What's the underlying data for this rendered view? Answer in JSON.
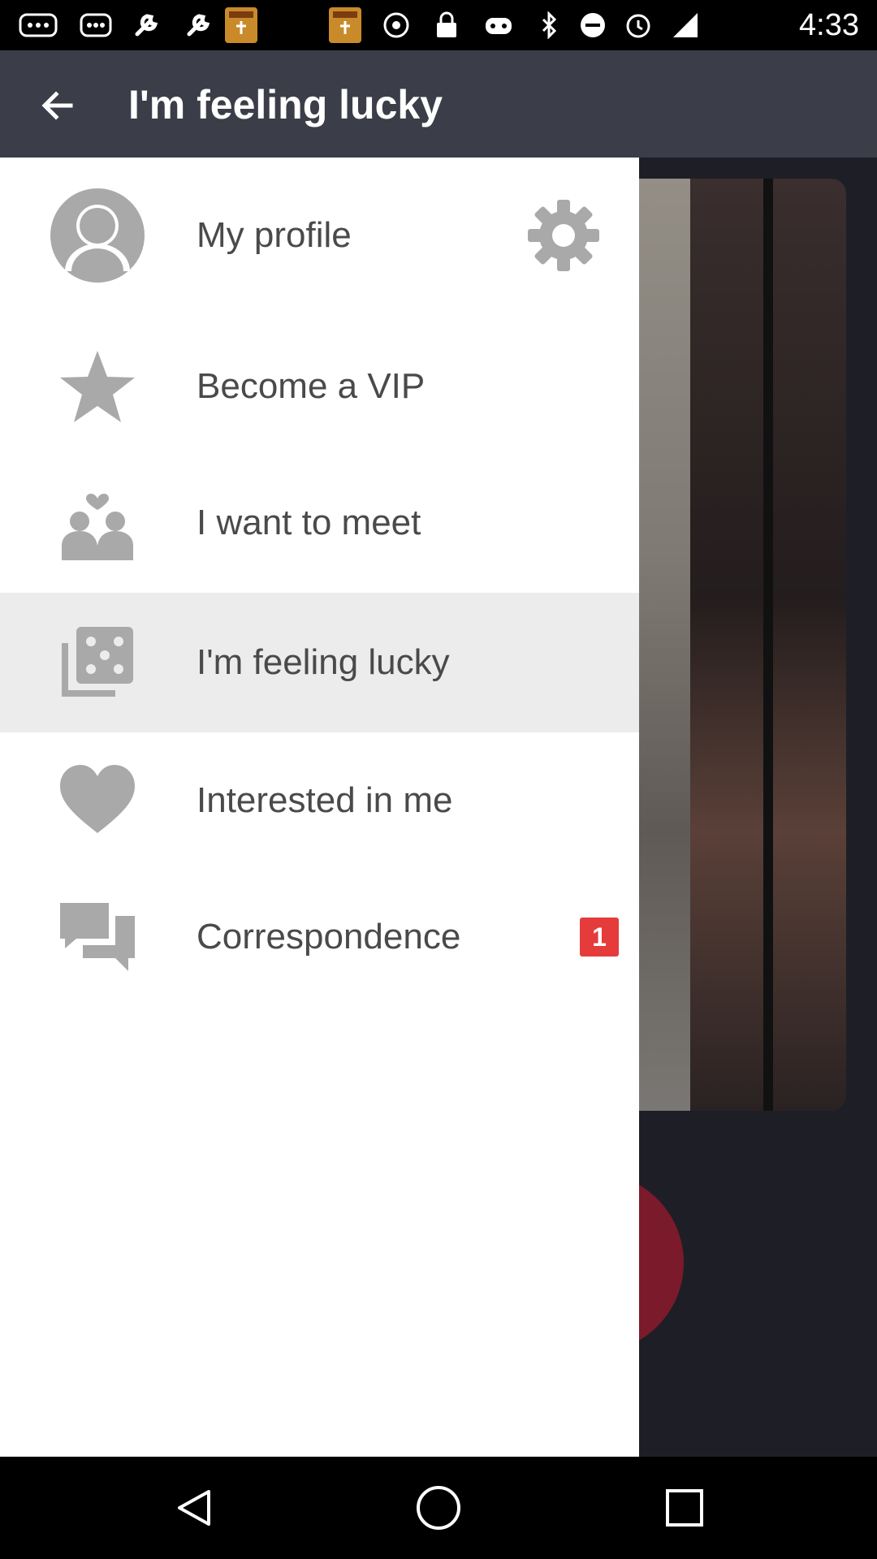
{
  "status_bar": {
    "time": "4:33",
    "icons": [
      "more-icon",
      "wrench-icon",
      "app-topics-icon",
      "app-topics-icon",
      "disc-icon",
      "lock-icon",
      "controller-icon",
      "bluetooth-icon",
      "dnd-icon",
      "alarm-icon",
      "signal-icon"
    ]
  },
  "app_bar": {
    "title": "I'm feeling lucky",
    "back_icon": "back-arrow-icon"
  },
  "drawer": {
    "items": [
      {
        "label": "My profile",
        "icon": "avatar-icon",
        "active": false
      },
      {
        "label": "Become a VIP",
        "icon": "star-icon",
        "active": false
      },
      {
        "label": "I want to meet",
        "icon": "couple-icon",
        "active": false
      },
      {
        "label": "I'm feeling lucky",
        "icon": "dice-icon",
        "active": true
      },
      {
        "label": "Interested in me",
        "icon": "heart-icon",
        "active": false
      },
      {
        "label": "Correspondence",
        "icon": "chat-icon",
        "active": false,
        "badge": "1"
      }
    ],
    "settings_icon": "gear-icon"
  },
  "colors": {
    "app_bar": "#3b3e48",
    "icon_gray": "#a9a9a9",
    "badge": "#e53b3b",
    "active_row": "#ececec"
  },
  "nav_bar": {
    "buttons": [
      "back-triangle-icon",
      "home-circle-icon",
      "recents-square-icon"
    ]
  }
}
